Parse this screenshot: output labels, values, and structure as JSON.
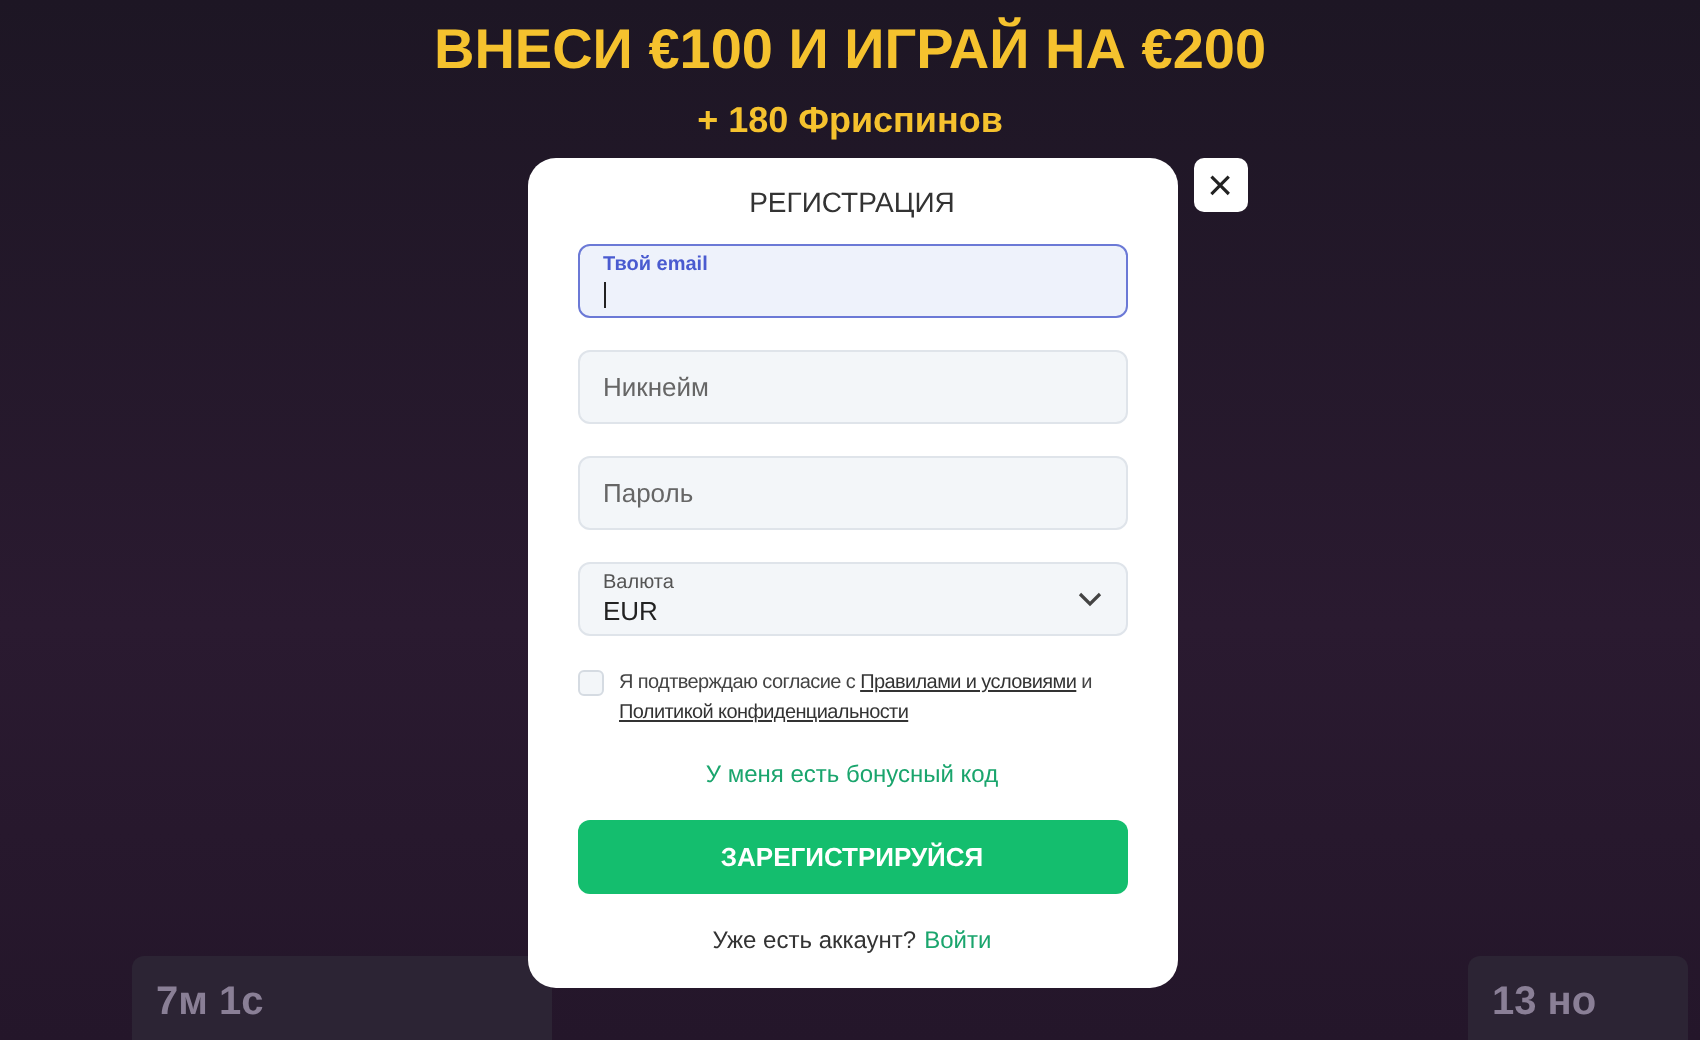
{
  "promo": {
    "headline": "ВНЕСИ €100 И ИГРАЙ НА €200",
    "subline": "+ 180 Фриспинов"
  },
  "background_cards": [
    {
      "value": "7м 1с"
    },
    {
      "value": "13 но"
    }
  ],
  "modal": {
    "title": "РЕГИСТРАЦИЯ",
    "close": "×",
    "fields": [
      {
        "kind": "text",
        "label": "Твой email",
        "focused": true
      },
      {
        "kind": "text",
        "placeholder": "Никнейм",
        "focused": false
      },
      {
        "kind": "text",
        "placeholder": "Пароль",
        "focused": false
      },
      {
        "kind": "select",
        "label": "Валюта",
        "value": "EUR",
        "focused": false
      }
    ],
    "consent": {
      "checked": false,
      "parts": [
        {
          "kind": "text",
          "text": "Я подтверждаю согласие с "
        },
        {
          "kind": "link",
          "text": "Правилами и условиями"
        },
        {
          "kind": "text",
          "text": " и "
        },
        {
          "kind": "link",
          "text": "Политикой конфиденциальности"
        }
      ]
    },
    "bonus_link": "У меня есть бонусный код",
    "submit": "ЗАРЕГИСТРИРУЙСЯ",
    "login_prompt": "Уже есть аккаунт?",
    "login_link": "Войти"
  }
}
